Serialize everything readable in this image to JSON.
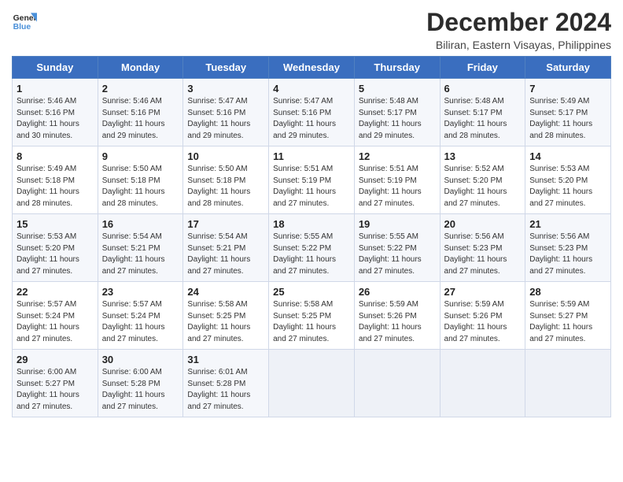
{
  "logo": {
    "line1": "General",
    "line2": "Blue"
  },
  "title": "December 2024",
  "subtitle": "Biliran, Eastern Visayas, Philippines",
  "weekdays": [
    "Sunday",
    "Monday",
    "Tuesday",
    "Wednesday",
    "Thursday",
    "Friday",
    "Saturday"
  ],
  "weeks": [
    [
      {
        "day": "1",
        "sunrise": "Sunrise: 5:46 AM",
        "sunset": "Sunset: 5:16 PM",
        "daylight": "Daylight: 11 hours and 30 minutes."
      },
      {
        "day": "2",
        "sunrise": "Sunrise: 5:46 AM",
        "sunset": "Sunset: 5:16 PM",
        "daylight": "Daylight: 11 hours and 29 minutes."
      },
      {
        "day": "3",
        "sunrise": "Sunrise: 5:47 AM",
        "sunset": "Sunset: 5:16 PM",
        "daylight": "Daylight: 11 hours and 29 minutes."
      },
      {
        "day": "4",
        "sunrise": "Sunrise: 5:47 AM",
        "sunset": "Sunset: 5:16 PM",
        "daylight": "Daylight: 11 hours and 29 minutes."
      },
      {
        "day": "5",
        "sunrise": "Sunrise: 5:48 AM",
        "sunset": "Sunset: 5:17 PM",
        "daylight": "Daylight: 11 hours and 29 minutes."
      },
      {
        "day": "6",
        "sunrise": "Sunrise: 5:48 AM",
        "sunset": "Sunset: 5:17 PM",
        "daylight": "Daylight: 11 hours and 28 minutes."
      },
      {
        "day": "7",
        "sunrise": "Sunrise: 5:49 AM",
        "sunset": "Sunset: 5:17 PM",
        "daylight": "Daylight: 11 hours and 28 minutes."
      }
    ],
    [
      {
        "day": "8",
        "sunrise": "Sunrise: 5:49 AM",
        "sunset": "Sunset: 5:18 PM",
        "daylight": "Daylight: 11 hours and 28 minutes."
      },
      {
        "day": "9",
        "sunrise": "Sunrise: 5:50 AM",
        "sunset": "Sunset: 5:18 PM",
        "daylight": "Daylight: 11 hours and 28 minutes."
      },
      {
        "day": "10",
        "sunrise": "Sunrise: 5:50 AM",
        "sunset": "Sunset: 5:18 PM",
        "daylight": "Daylight: 11 hours and 28 minutes."
      },
      {
        "day": "11",
        "sunrise": "Sunrise: 5:51 AM",
        "sunset": "Sunset: 5:19 PM",
        "daylight": "Daylight: 11 hours and 27 minutes."
      },
      {
        "day": "12",
        "sunrise": "Sunrise: 5:51 AM",
        "sunset": "Sunset: 5:19 PM",
        "daylight": "Daylight: 11 hours and 27 minutes."
      },
      {
        "day": "13",
        "sunrise": "Sunrise: 5:52 AM",
        "sunset": "Sunset: 5:20 PM",
        "daylight": "Daylight: 11 hours and 27 minutes."
      },
      {
        "day": "14",
        "sunrise": "Sunrise: 5:53 AM",
        "sunset": "Sunset: 5:20 PM",
        "daylight": "Daylight: 11 hours and 27 minutes."
      }
    ],
    [
      {
        "day": "15",
        "sunrise": "Sunrise: 5:53 AM",
        "sunset": "Sunset: 5:20 PM",
        "daylight": "Daylight: 11 hours and 27 minutes."
      },
      {
        "day": "16",
        "sunrise": "Sunrise: 5:54 AM",
        "sunset": "Sunset: 5:21 PM",
        "daylight": "Daylight: 11 hours and 27 minutes."
      },
      {
        "day": "17",
        "sunrise": "Sunrise: 5:54 AM",
        "sunset": "Sunset: 5:21 PM",
        "daylight": "Daylight: 11 hours and 27 minutes."
      },
      {
        "day": "18",
        "sunrise": "Sunrise: 5:55 AM",
        "sunset": "Sunset: 5:22 PM",
        "daylight": "Daylight: 11 hours and 27 minutes."
      },
      {
        "day": "19",
        "sunrise": "Sunrise: 5:55 AM",
        "sunset": "Sunset: 5:22 PM",
        "daylight": "Daylight: 11 hours and 27 minutes."
      },
      {
        "day": "20",
        "sunrise": "Sunrise: 5:56 AM",
        "sunset": "Sunset: 5:23 PM",
        "daylight": "Daylight: 11 hours and 27 minutes."
      },
      {
        "day": "21",
        "sunrise": "Sunrise: 5:56 AM",
        "sunset": "Sunset: 5:23 PM",
        "daylight": "Daylight: 11 hours and 27 minutes."
      }
    ],
    [
      {
        "day": "22",
        "sunrise": "Sunrise: 5:57 AM",
        "sunset": "Sunset: 5:24 PM",
        "daylight": "Daylight: 11 hours and 27 minutes."
      },
      {
        "day": "23",
        "sunrise": "Sunrise: 5:57 AM",
        "sunset": "Sunset: 5:24 PM",
        "daylight": "Daylight: 11 hours and 27 minutes."
      },
      {
        "day": "24",
        "sunrise": "Sunrise: 5:58 AM",
        "sunset": "Sunset: 5:25 PM",
        "daylight": "Daylight: 11 hours and 27 minutes."
      },
      {
        "day": "25",
        "sunrise": "Sunrise: 5:58 AM",
        "sunset": "Sunset: 5:25 PM",
        "daylight": "Daylight: 11 hours and 27 minutes."
      },
      {
        "day": "26",
        "sunrise": "Sunrise: 5:59 AM",
        "sunset": "Sunset: 5:26 PM",
        "daylight": "Daylight: 11 hours and 27 minutes."
      },
      {
        "day": "27",
        "sunrise": "Sunrise: 5:59 AM",
        "sunset": "Sunset: 5:26 PM",
        "daylight": "Daylight: 11 hours and 27 minutes."
      },
      {
        "day": "28",
        "sunrise": "Sunrise: 5:59 AM",
        "sunset": "Sunset: 5:27 PM",
        "daylight": "Daylight: 11 hours and 27 minutes."
      }
    ],
    [
      {
        "day": "29",
        "sunrise": "Sunrise: 6:00 AM",
        "sunset": "Sunset: 5:27 PM",
        "daylight": "Daylight: 11 hours and 27 minutes."
      },
      {
        "day": "30",
        "sunrise": "Sunrise: 6:00 AM",
        "sunset": "Sunset: 5:28 PM",
        "daylight": "Daylight: 11 hours and 27 minutes."
      },
      {
        "day": "31",
        "sunrise": "Sunrise: 6:01 AM",
        "sunset": "Sunset: 5:28 PM",
        "daylight": "Daylight: 11 hours and 27 minutes."
      },
      null,
      null,
      null,
      null
    ]
  ]
}
